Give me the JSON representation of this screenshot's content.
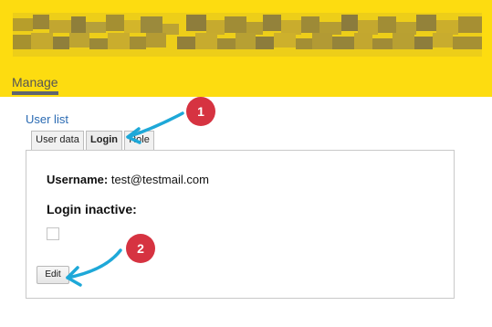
{
  "header": {
    "nav_item": "Manage"
  },
  "breadcrumb": {
    "user_list_link": "User list"
  },
  "tabs": [
    {
      "label": "User data"
    },
    {
      "label": "Login"
    },
    {
      "label": "Role"
    }
  ],
  "panel": {
    "username_label": "Username:",
    "username_value": "test@testmail.com",
    "login_inactive_label": "Login inactive:",
    "edit_button": "Edit"
  },
  "annotations": {
    "badge_1": "1",
    "badge_2": "2"
  },
  "colors": {
    "header_background": "#fddc10",
    "link": "#2b6bb3",
    "badge": "#d63341",
    "arrow": "#1ea8d8"
  }
}
